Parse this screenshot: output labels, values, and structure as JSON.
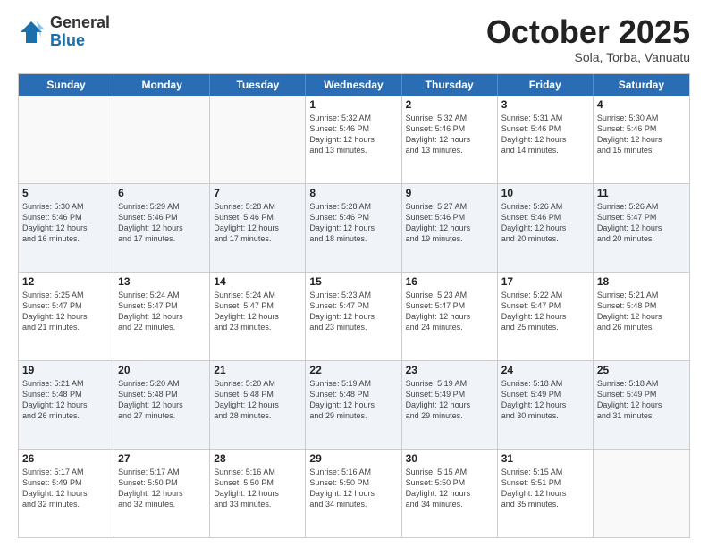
{
  "logo": {
    "general": "General",
    "blue": "Blue"
  },
  "title": "October 2025",
  "subtitle": "Sola, Torba, Vanuatu",
  "header_days": [
    "Sunday",
    "Monday",
    "Tuesday",
    "Wednesday",
    "Thursday",
    "Friday",
    "Saturday"
  ],
  "weeks": [
    [
      {
        "day": "",
        "info": ""
      },
      {
        "day": "",
        "info": ""
      },
      {
        "day": "",
        "info": ""
      },
      {
        "day": "1",
        "info": "Sunrise: 5:32 AM\nSunset: 5:46 PM\nDaylight: 12 hours\nand 13 minutes."
      },
      {
        "day": "2",
        "info": "Sunrise: 5:32 AM\nSunset: 5:46 PM\nDaylight: 12 hours\nand 13 minutes."
      },
      {
        "day": "3",
        "info": "Sunrise: 5:31 AM\nSunset: 5:46 PM\nDaylight: 12 hours\nand 14 minutes."
      },
      {
        "day": "4",
        "info": "Sunrise: 5:30 AM\nSunset: 5:46 PM\nDaylight: 12 hours\nand 15 minutes."
      }
    ],
    [
      {
        "day": "5",
        "info": "Sunrise: 5:30 AM\nSunset: 5:46 PM\nDaylight: 12 hours\nand 16 minutes."
      },
      {
        "day": "6",
        "info": "Sunrise: 5:29 AM\nSunset: 5:46 PM\nDaylight: 12 hours\nand 17 minutes."
      },
      {
        "day": "7",
        "info": "Sunrise: 5:28 AM\nSunset: 5:46 PM\nDaylight: 12 hours\nand 17 minutes."
      },
      {
        "day": "8",
        "info": "Sunrise: 5:28 AM\nSunset: 5:46 PM\nDaylight: 12 hours\nand 18 minutes."
      },
      {
        "day": "9",
        "info": "Sunrise: 5:27 AM\nSunset: 5:46 PM\nDaylight: 12 hours\nand 19 minutes."
      },
      {
        "day": "10",
        "info": "Sunrise: 5:26 AM\nSunset: 5:46 PM\nDaylight: 12 hours\nand 20 minutes."
      },
      {
        "day": "11",
        "info": "Sunrise: 5:26 AM\nSunset: 5:47 PM\nDaylight: 12 hours\nand 20 minutes."
      }
    ],
    [
      {
        "day": "12",
        "info": "Sunrise: 5:25 AM\nSunset: 5:47 PM\nDaylight: 12 hours\nand 21 minutes."
      },
      {
        "day": "13",
        "info": "Sunrise: 5:24 AM\nSunset: 5:47 PM\nDaylight: 12 hours\nand 22 minutes."
      },
      {
        "day": "14",
        "info": "Sunrise: 5:24 AM\nSunset: 5:47 PM\nDaylight: 12 hours\nand 23 minutes."
      },
      {
        "day": "15",
        "info": "Sunrise: 5:23 AM\nSunset: 5:47 PM\nDaylight: 12 hours\nand 23 minutes."
      },
      {
        "day": "16",
        "info": "Sunrise: 5:23 AM\nSunset: 5:47 PM\nDaylight: 12 hours\nand 24 minutes."
      },
      {
        "day": "17",
        "info": "Sunrise: 5:22 AM\nSunset: 5:47 PM\nDaylight: 12 hours\nand 25 minutes."
      },
      {
        "day": "18",
        "info": "Sunrise: 5:21 AM\nSunset: 5:48 PM\nDaylight: 12 hours\nand 26 minutes."
      }
    ],
    [
      {
        "day": "19",
        "info": "Sunrise: 5:21 AM\nSunset: 5:48 PM\nDaylight: 12 hours\nand 26 minutes."
      },
      {
        "day": "20",
        "info": "Sunrise: 5:20 AM\nSunset: 5:48 PM\nDaylight: 12 hours\nand 27 minutes."
      },
      {
        "day": "21",
        "info": "Sunrise: 5:20 AM\nSunset: 5:48 PM\nDaylight: 12 hours\nand 28 minutes."
      },
      {
        "day": "22",
        "info": "Sunrise: 5:19 AM\nSunset: 5:48 PM\nDaylight: 12 hours\nand 29 minutes."
      },
      {
        "day": "23",
        "info": "Sunrise: 5:19 AM\nSunset: 5:49 PM\nDaylight: 12 hours\nand 29 minutes."
      },
      {
        "day": "24",
        "info": "Sunrise: 5:18 AM\nSunset: 5:49 PM\nDaylight: 12 hours\nand 30 minutes."
      },
      {
        "day": "25",
        "info": "Sunrise: 5:18 AM\nSunset: 5:49 PM\nDaylight: 12 hours\nand 31 minutes."
      }
    ],
    [
      {
        "day": "26",
        "info": "Sunrise: 5:17 AM\nSunset: 5:49 PM\nDaylight: 12 hours\nand 32 minutes."
      },
      {
        "day": "27",
        "info": "Sunrise: 5:17 AM\nSunset: 5:50 PM\nDaylight: 12 hours\nand 32 minutes."
      },
      {
        "day": "28",
        "info": "Sunrise: 5:16 AM\nSunset: 5:50 PM\nDaylight: 12 hours\nand 33 minutes."
      },
      {
        "day": "29",
        "info": "Sunrise: 5:16 AM\nSunset: 5:50 PM\nDaylight: 12 hours\nand 34 minutes."
      },
      {
        "day": "30",
        "info": "Sunrise: 5:15 AM\nSunset: 5:50 PM\nDaylight: 12 hours\nand 34 minutes."
      },
      {
        "day": "31",
        "info": "Sunrise: 5:15 AM\nSunset: 5:51 PM\nDaylight: 12 hours\nand 35 minutes."
      },
      {
        "day": "",
        "info": ""
      }
    ]
  ]
}
